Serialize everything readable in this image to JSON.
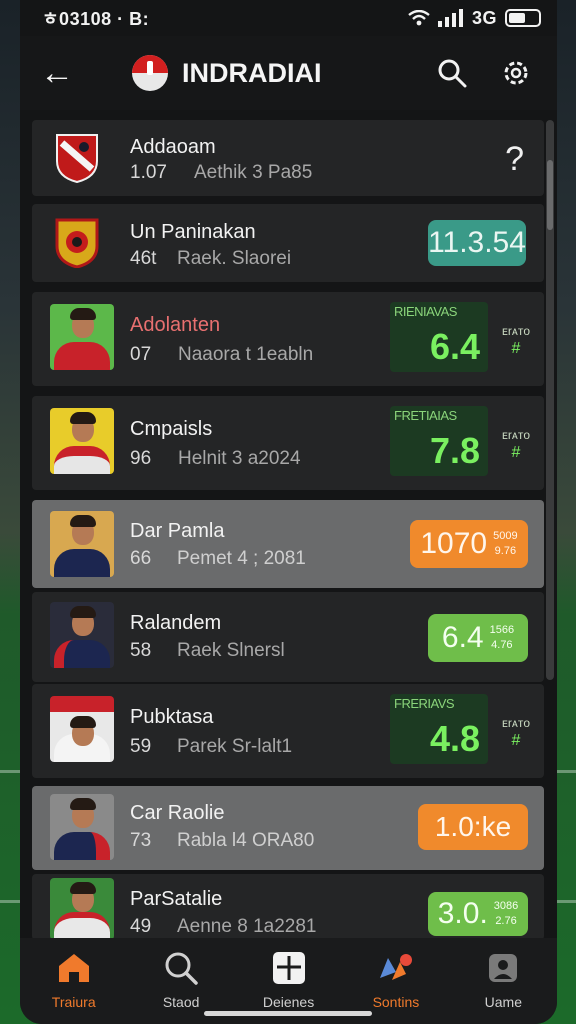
{
  "status": {
    "time": "ㅎ03108 · B:",
    "network": "3G"
  },
  "appbar": {
    "title": "INDRADIAI"
  },
  "rows": [
    {
      "name": "Addaoam",
      "number": "1.07",
      "sub": "Aethik 3 Pa85",
      "action": "?"
    },
    {
      "name": "Un Paninakan",
      "number": "46t",
      "sub": "Raek. Slaorei",
      "badge": "11.3.54"
    },
    {
      "name": "Adolanten",
      "number": "07",
      "sub": "Naaora t 1eabln",
      "panel_label": "RIENIAVAS",
      "panel_value": "6.4",
      "side_top": "ᴇrᴀᴛᴏ",
      "side_mark": "#"
    },
    {
      "name": "Cmpaisls",
      "number": "96",
      "sub": "Helnit 3 a2024",
      "panel_label": "FRETIAIAS",
      "panel_value": "7.8",
      "side_top": "ᴇrᴀᴛᴏ",
      "side_mark": "#"
    },
    {
      "name": "Dar Pamla",
      "number": "66",
      "sub": "Pemet 4 ; 2081",
      "badge": "1070",
      "badge_mini": [
        "5009",
        "9.76"
      ]
    },
    {
      "name": "Ralandem",
      "number": "58",
      "sub": "Raek Slnersl",
      "badge": "6.4",
      "badge_mini": [
        "1566",
        "4.76"
      ]
    },
    {
      "name": "Pubktasa",
      "number": "59",
      "sub": "Parek Sr-lalt1",
      "panel_label": "FRERIAVS",
      "panel_value": "4.8",
      "side_top": "ᴇrᴀᴛᴏ",
      "side_mark": "#"
    },
    {
      "name": "Car Raolie",
      "number": "73",
      "sub": "Rabla l4 ORA80",
      "badge": "1.0:ke"
    },
    {
      "name": "ParSatalie",
      "number": "49",
      "sub": "Aenne 8 1a2281",
      "badge": "3.0.",
      "badge_mini": [
        "3086",
        "2.76"
      ]
    }
  ],
  "nav": [
    {
      "label": "Traiura",
      "icon": "home-icon",
      "active": true
    },
    {
      "label": "Staod",
      "icon": "search-icon"
    },
    {
      "label": "Deienes",
      "icon": "grid-icon"
    },
    {
      "label": "Sontins",
      "icon": "chart-icon",
      "active": true
    },
    {
      "label": "Uame",
      "icon": "profile-icon"
    }
  ],
  "colors": {
    "accent_orange": "#f08a2c",
    "accent_green": "#6fbe4a",
    "teal": "#3a9a88",
    "highlight_row": "#6a6b6c"
  }
}
